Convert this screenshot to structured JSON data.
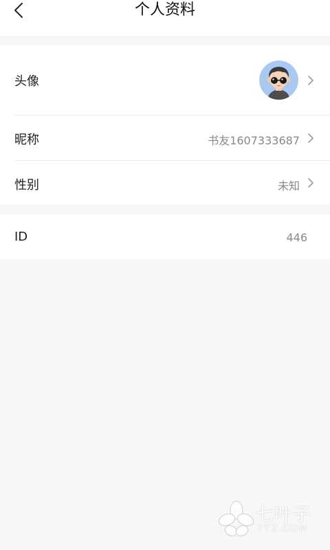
{
  "header": {
    "title": "个人资料",
    "back_icon": "chevron-left-icon"
  },
  "profile": {
    "avatar": {
      "label": "头像"
    },
    "nickname": {
      "label": "昵称",
      "value": "书友1607333687"
    },
    "gender": {
      "label": "性别",
      "value": "未知"
    }
  },
  "account": {
    "id": {
      "label": "ID",
      "value": "446"
    }
  },
  "watermark": {
    "text": "七叶子",
    "subtext": "7YZ.COM"
  },
  "colors": {
    "background": "#f7f7f7",
    "card": "#ffffff",
    "primary_text": "#222222",
    "secondary_text": "#888888",
    "divider": "#ececec"
  }
}
